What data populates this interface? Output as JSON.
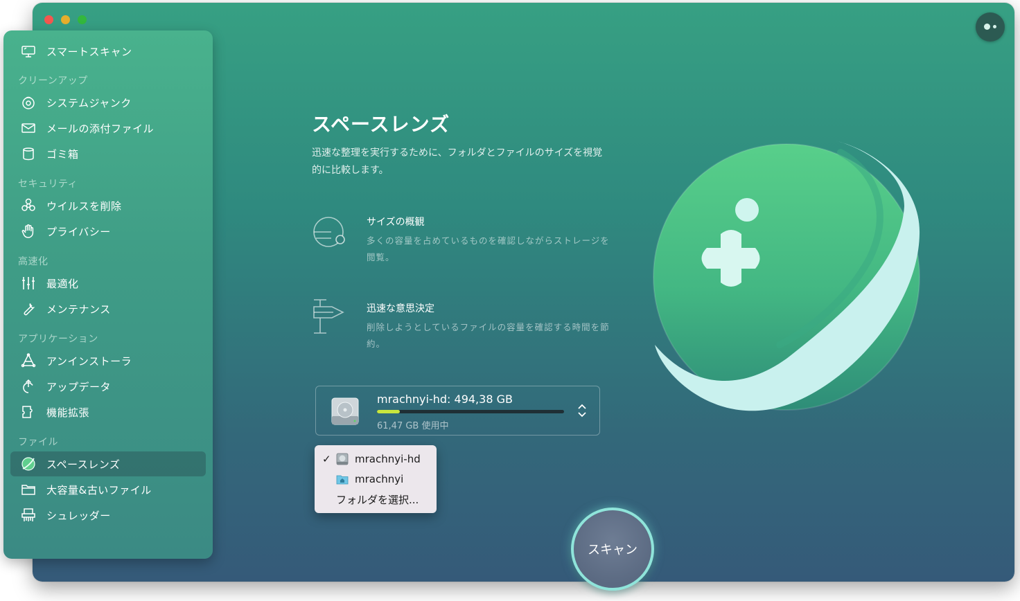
{
  "sidebar": {
    "smart_scan": "スマートスキャン",
    "sections": {
      "cleanup": "クリーンアップ",
      "security": "セキュリティ",
      "speed": "高速化",
      "applications": "アプリケーション",
      "files": "ファイル"
    },
    "items": {
      "system_junk": "システムジャンク",
      "mail_attachments": "メールの添付ファイル",
      "trash": "ゴミ箱",
      "malware_removal": "ウイルスを削除",
      "privacy": "プライバシー",
      "optimization": "最適化",
      "maintenance": "メンテナンス",
      "uninstaller": "アンインストーラ",
      "updater": "アップデータ",
      "extensions": "機能拡張",
      "space_lens": "スペースレンズ",
      "large_old_files": "大容量&古いファイル",
      "shredder": "シュレッダー"
    },
    "active": "space_lens"
  },
  "main": {
    "title": "スペースレンズ",
    "description": "迅速な整理を実行するために、フォルダとファイルのサイズを視覚的に比較します。",
    "features": [
      {
        "icon": "size-overview-icon",
        "title": "サイズの概観",
        "desc": "多くの容量を占めているものを確認しながらストレージを閲覧。"
      },
      {
        "icon": "quick-decision-icon",
        "title": "迅速な意思決定",
        "desc": "削除しようとしているファイルの容量を確認する時間を節約。"
      }
    ],
    "disk": {
      "name": "mrachnyi-hd: 494,38 GB",
      "used": "61,47 GB 使用中",
      "used_fraction": 0.124
    },
    "dropdown": {
      "options": [
        "mrachnyi-hd",
        "mrachnyi",
        "フォルダを選択..."
      ],
      "selected": "mrachnyi-hd",
      "checkmark": "✓"
    },
    "scan_button": "スキャン"
  },
  "colors": {
    "accent": "#8fe4da",
    "progress": "#c9e63d",
    "sidebar_top": "#49b28d",
    "window_bottom": "#355a79"
  }
}
